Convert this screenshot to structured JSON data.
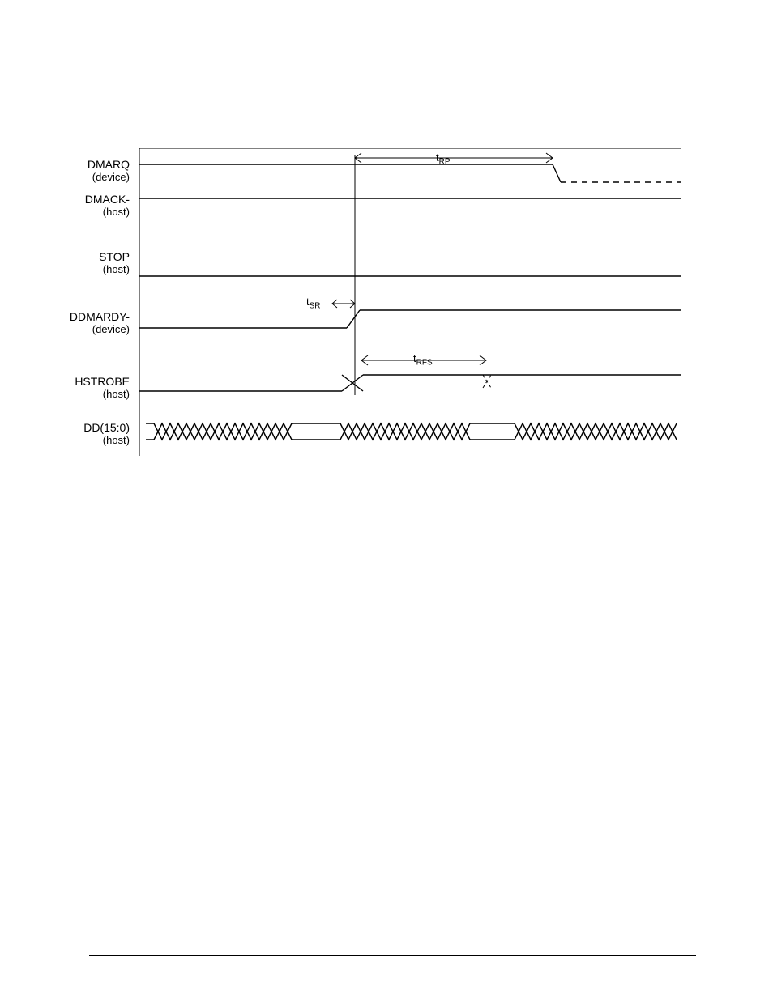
{
  "signals": {
    "dmarq": {
      "name": "DMARQ",
      "role": "(device)"
    },
    "dmack": {
      "name": "DMACK-",
      "role": "(host)"
    },
    "stop": {
      "name": "STOP",
      "role": "(host)"
    },
    "ddmardy": {
      "name": "DDMARDY-",
      "role": "(device)"
    },
    "hstrobe": {
      "name": "HSTROBE",
      "role": "(host)"
    },
    "dd": {
      "name": "DD(15:0)",
      "role": "(host)"
    }
  },
  "timing_labels": {
    "tRP": "RP",
    "tSR": "SR",
    "tRFS": "RFS"
  }
}
